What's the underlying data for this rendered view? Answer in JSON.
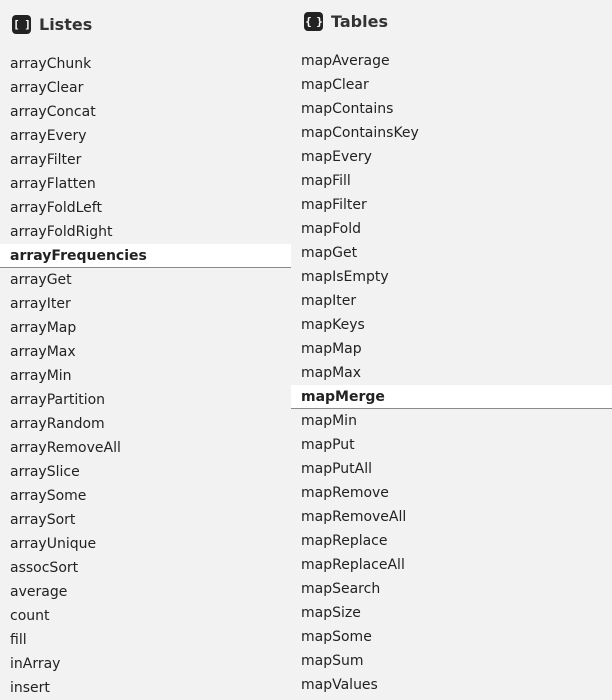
{
  "left": {
    "icon": "[ ]",
    "title": "Listes",
    "active": "arrayFrequencies",
    "items": [
      "arrayChunk",
      "arrayClear",
      "arrayConcat",
      "arrayEvery",
      "arrayFilter",
      "arrayFlatten",
      "arrayFoldLeft",
      "arrayFoldRight",
      "arrayFrequencies",
      "arrayGet",
      "arrayIter",
      "arrayMap",
      "arrayMax",
      "arrayMin",
      "arrayPartition",
      "arrayRandom",
      "arrayRemoveAll",
      "arraySlice",
      "arraySome",
      "arraySort",
      "arrayUnique",
      "assocSort",
      "average",
      "count",
      "fill",
      "inArray",
      "insert"
    ]
  },
  "right": {
    "icon": "{ }",
    "title": "Tables",
    "active": "mapMerge",
    "items": [
      "mapAverage",
      "mapClear",
      "mapContains",
      "mapContainsKey",
      "mapEvery",
      "mapFill",
      "mapFilter",
      "mapFold",
      "mapGet",
      "mapIsEmpty",
      "mapIter",
      "mapKeys",
      "mapMap",
      "mapMax",
      "mapMerge",
      "mapMin",
      "mapPut",
      "mapPutAll",
      "mapRemove",
      "mapRemoveAll",
      "mapReplace",
      "mapReplaceAll",
      "mapSearch",
      "mapSize",
      "mapSome",
      "mapSum",
      "mapValues"
    ]
  },
  "icons": {
    "left": "brackets-icon",
    "right": "braces-icon"
  },
  "colors": {
    "background": "#f2f2f2",
    "active_background": "#ffffff",
    "text": "#222222"
  }
}
